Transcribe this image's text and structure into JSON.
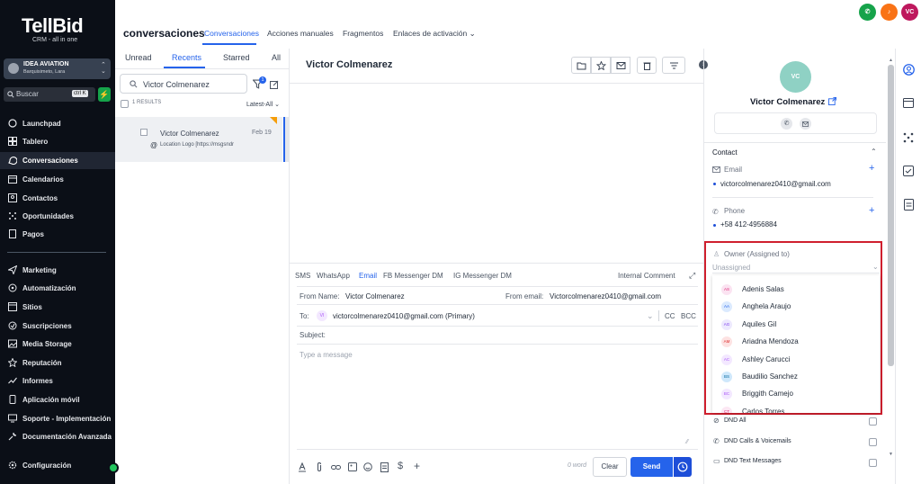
{
  "brand": {
    "logo": "TellBid",
    "tagline": "CRM - all in one"
  },
  "account": {
    "name": "IDEA AVIATION",
    "location": "Barquisimeto, Lara"
  },
  "search": {
    "label": "Buscar",
    "shortcut": "ctrl K"
  },
  "nav": {
    "launchpad": "Launchpad",
    "tablero": "Tablero",
    "conversaciones": "Conversaciones",
    "calendarios": "Calendarios",
    "contactos": "Contactos",
    "oportunidades": "Oportunidades",
    "pagos": "Pagos",
    "marketing": "Marketing",
    "automatizacion": "Automatización",
    "sitios": "Sitios",
    "suscripciones": "Suscripciones",
    "media": "Media Storage",
    "reputacion": "Reputación",
    "informes": "Informes",
    "app": "Aplicación móvil",
    "soporte": "Soporte - Implementación",
    "docs": "Documentación Avanzada",
    "config": "Configuración"
  },
  "header": {
    "title": "conversaciones",
    "tabs": {
      "conversaciones": "Conversaciones",
      "manuales": "Acciones manuales",
      "fragmentos": "Fragmentos",
      "enlaces": "Enlaces de activación"
    },
    "user_initials": "VC"
  },
  "list": {
    "tabs": {
      "unread": "Unread",
      "recents": "Recents",
      "starred": "Starred",
      "all": "All"
    },
    "search_value": "Victor Colmenarez",
    "filter_count": "1",
    "results": "1 RESULTS",
    "sort": "Latest-All",
    "conversation": {
      "name": "Victor Colmenarez",
      "date": "Feb 19",
      "preview": "Location Logo [https://msgsndr"
    }
  },
  "thread": {
    "contact_name": "Victor Colmenarez",
    "channels": {
      "sms": "SMS",
      "whatsapp": "WhatsApp",
      "email": "Email",
      "fb": "FB Messenger DM",
      "ig": "IG Messenger DM"
    },
    "internal_comment": "Internal Comment",
    "from_name_label": "From Name:",
    "from_name": "Victor Colmenarez",
    "from_email_label": "From email:",
    "from_email": "Victorcolmenarez0410@gmail.com",
    "to_label": "To:",
    "to_initials": "VI",
    "to_value": "victorcolmenarez0410@gmail.com (Primary)",
    "cc": "CC",
    "bcc": "BCC",
    "subject_label": "Subject:",
    "message_placeholder": "Type a message",
    "word_count": "0 word",
    "clear": "Clear",
    "send": "Send"
  },
  "contact": {
    "initials": "VC",
    "name": "Victor Colmenarez",
    "section": "Contact",
    "email_label": "Email",
    "email": "victorcolmenarez0410@gmail.com",
    "phone_label": "Phone",
    "phone": "+58 412-4956884",
    "owner_label": "Owner (Assigned to)",
    "owner_placeholder": "Unassigned",
    "owners": [
      {
        "initials": "AS",
        "name": "Adenis Salas",
        "bg": "#fbe3f1",
        "fg": "#db2777"
      },
      {
        "initials": "AA",
        "name": "Anghela Araujo",
        "bg": "#dbeafe",
        "fg": "#2563eb"
      },
      {
        "initials": "AG",
        "name": "Aquiles Gil",
        "bg": "#ede9fe",
        "fg": "#7c3aed"
      },
      {
        "initials": "AM",
        "name": "Ariadna Mendoza",
        "bg": "#fde2e2",
        "fg": "#dc2626"
      },
      {
        "initials": "AC",
        "name": "Ashley Carucci",
        "bg": "#f3e8ff",
        "fg": "#a855f7"
      },
      {
        "initials": "BS",
        "name": "Baudilio Sanchez",
        "bg": "#cfe8fb",
        "fg": "#0369a1"
      },
      {
        "initials": "BC",
        "name": "Briggith Camejo",
        "bg": "#f3e8ff",
        "fg": "#a855f7"
      },
      {
        "initials": "CT",
        "name": "Carlos Torres",
        "bg": "#fce7f3",
        "fg": "#db2777"
      }
    ],
    "dnd_all": "DND All",
    "dnd_calls": "DND Calls & Voicemails",
    "dnd_text": "DND Text Messages"
  },
  "colors": {
    "accent": "#2563eb",
    "highlight": "#cf1f2e",
    "phone": "#16a34a",
    "bell": "#f97316",
    "user": "#be185d"
  }
}
